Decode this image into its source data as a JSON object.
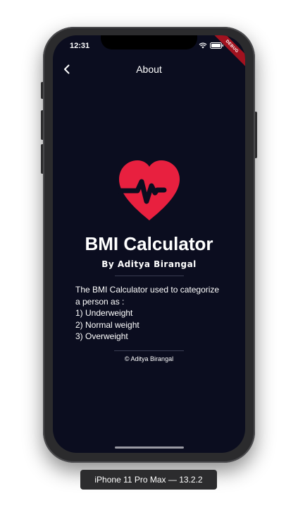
{
  "status_bar": {
    "time": "12:31",
    "icons": [
      "wifi-icon",
      "battery-icon"
    ],
    "debug_banner": "DEBUG"
  },
  "app_bar": {
    "back_icon": "back-arrow-icon",
    "title": "About"
  },
  "content": {
    "logo_icon": "heart-pulse-icon",
    "app_name": "BMI Calculator",
    "author": "By Aditya Birangal",
    "description_lines": [
      "The BMI Calculator used to categorize",
      "a person as :",
      "1) Underweight",
      "2) Normal weight",
      "3) Overweight"
    ],
    "copyright": "© Aditya Birangal"
  },
  "simulator": {
    "device_label": "iPhone 11 Pro Max — 13.2.2"
  },
  "colors": {
    "screen_background": "#0b0d1f",
    "accent_red": "#e8203f",
    "debug_ribbon": "#a2121f",
    "text": "#ffffff"
  }
}
